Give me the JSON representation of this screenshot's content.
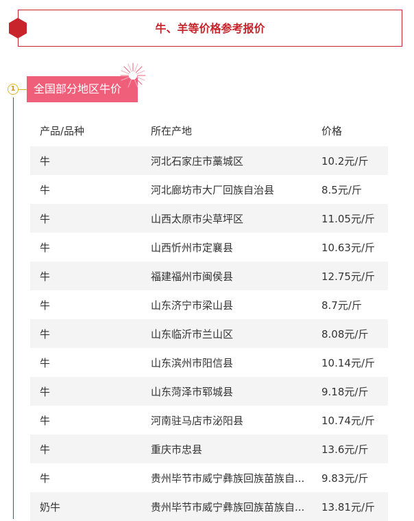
{
  "header": {
    "title": "牛、羊等价格参考报价"
  },
  "section": {
    "number": "1",
    "title": "全国部分地区牛价"
  },
  "table": {
    "columns": [
      "产品/品种",
      "所在产地",
      "价格"
    ],
    "rows": [
      [
        "牛",
        "河北石家庄市藁城区",
        "10.2元/斤"
      ],
      [
        "牛",
        "河北廊坊市大厂回族自治县",
        "8.5元/斤"
      ],
      [
        "牛",
        "山西太原市尖草坪区",
        "11.05元/斤"
      ],
      [
        "牛",
        "山西忻州市定襄县",
        "10.63元/斤"
      ],
      [
        "牛",
        "福建福州市闽侯县",
        "12.75元/斤"
      ],
      [
        "牛",
        "山东济宁市梁山县",
        "8.7元/斤"
      ],
      [
        "牛",
        "山东临沂市兰山区",
        "8.08元/斤"
      ],
      [
        "牛",
        "山东滨州市阳信县",
        "10.14元/斤"
      ],
      [
        "牛",
        "山东菏泽市郓城县",
        "9.18元/斤"
      ],
      [
        "牛",
        "河南驻马店市泌阳县",
        "10.74元/斤"
      ],
      [
        "牛",
        "重庆市忠县",
        "13.6元/斤"
      ],
      [
        "牛",
        "贵州毕节市威宁彝族回族苗族自...",
        "9.83元/斤"
      ],
      [
        "奶牛",
        "贵州毕节市威宁彝族回族苗族自...",
        "13.81元/斤"
      ]
    ]
  },
  "colors": {
    "accent": "#c8242b",
    "tag": "#ef5f7a",
    "badge": "#e1b222"
  }
}
